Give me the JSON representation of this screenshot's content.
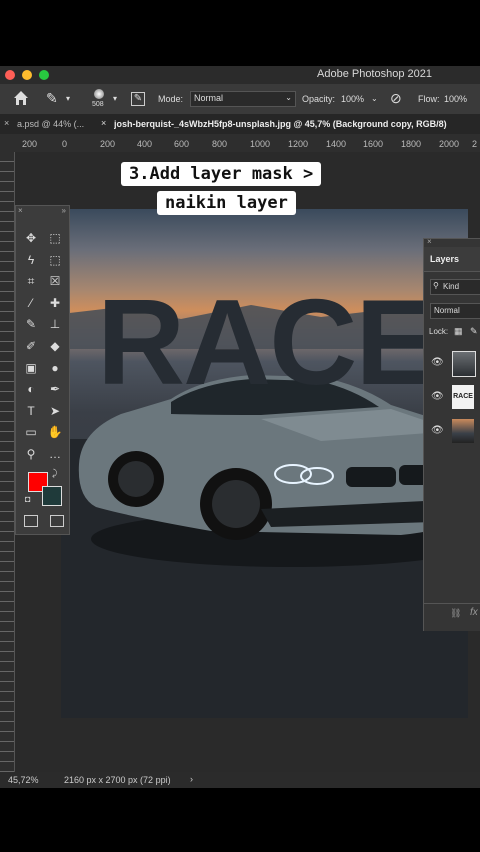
{
  "window": {
    "title": "Adobe Photoshop 2021"
  },
  "options_bar": {
    "brush_size": "508",
    "mode_label": "Mode:",
    "mode_value": "Normal",
    "opacity_label": "Opacity:",
    "opacity_value": "100%",
    "flow_label": "Flow:",
    "flow_value": "100%"
  },
  "tabs": [
    {
      "label": "a.psd @ 44% (..."
    },
    {
      "label": "josh-berquist-_4sWbzH5fp8-unsplash.jpg @ 45,7% (Background copy, RGB/8)"
    }
  ],
  "ruler_top": [
    "200",
    "0",
    "200",
    "400",
    "600",
    "800",
    "1000",
    "1200",
    "1400",
    "1600",
    "1800",
    "2000",
    "2"
  ],
  "caption": {
    "line1": "3.Add layer mask >",
    "line2": "naikin layer"
  },
  "canvas": {
    "headline": "RACE"
  },
  "tools": [
    {
      "icon": "move-icon",
      "glyph": "✥"
    },
    {
      "icon": "marquee-icon",
      "glyph": "⬚"
    },
    {
      "icon": "lasso-icon",
      "glyph": "ϟ"
    },
    {
      "icon": "object-select-icon",
      "glyph": "⬚"
    },
    {
      "icon": "crop-icon",
      "glyph": "⌗"
    },
    {
      "icon": "frame-icon",
      "glyph": "☒"
    },
    {
      "icon": "eyedropper-icon",
      "glyph": "⁄"
    },
    {
      "icon": "healing-icon",
      "glyph": "✚"
    },
    {
      "icon": "brush-icon",
      "glyph": "✎"
    },
    {
      "icon": "stamp-icon",
      "glyph": "⊥"
    },
    {
      "icon": "history-brush-icon",
      "glyph": "✐"
    },
    {
      "icon": "eraser-icon",
      "glyph": "◆"
    },
    {
      "icon": "gradient-icon",
      "glyph": "▣"
    },
    {
      "icon": "blur-icon",
      "glyph": "●"
    },
    {
      "icon": "dodge-icon",
      "glyph": "◐"
    },
    {
      "icon": "pen-icon",
      "glyph": "✒"
    },
    {
      "icon": "type-icon",
      "glyph": "T"
    },
    {
      "icon": "path-select-icon",
      "glyph": "➤"
    },
    {
      "icon": "rectangle-icon",
      "glyph": "▭"
    },
    {
      "icon": "hand-icon",
      "glyph": "✋"
    },
    {
      "icon": "zoom-icon",
      "glyph": "⚲"
    },
    {
      "icon": "more-icon",
      "glyph": "…"
    }
  ],
  "colors": {
    "foreground": "#ff0000",
    "background": "#1f3a3a"
  },
  "layers_panel": {
    "title": "Layers",
    "kind_label": "Kind",
    "blend_mode": "Normal",
    "lock_label": "Lock:",
    "layers": [
      {
        "thumb": "car-photo",
        "visible": true
      },
      {
        "thumb": "race-text",
        "thumb_text": "RACE",
        "visible": true
      },
      {
        "thumb": "background-photo",
        "visible": true
      }
    ]
  },
  "status_bar": {
    "zoom": "45,72%",
    "doc_info": "2160 px x 2700 px (72 ppi)"
  }
}
